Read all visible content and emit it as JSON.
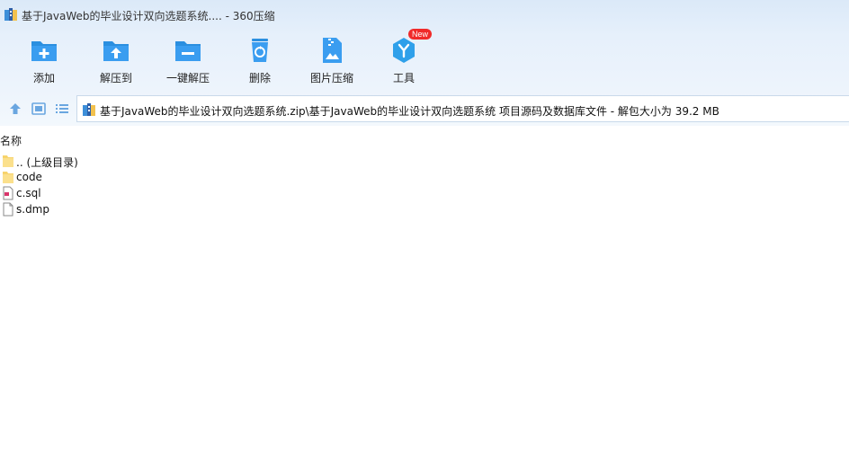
{
  "window": {
    "title": "基于JavaWeb的毕业设计双向选题系统.... - 360压缩"
  },
  "toolbar": {
    "items": [
      {
        "label": "添加",
        "icon": "add-folder-icon"
      },
      {
        "label": "解压到",
        "icon": "extract-to-icon"
      },
      {
        "label": "一键解压",
        "icon": "one-click-extract-icon"
      },
      {
        "label": "删除",
        "icon": "recycle-bin-icon"
      },
      {
        "label": "图片压缩",
        "icon": "image-compress-icon"
      },
      {
        "label": "工具",
        "icon": "tools-icon",
        "badge": "New"
      }
    ]
  },
  "navbar": {
    "path": "基于JavaWeb的毕业设计双向选题系统.zip\\基于JavaWeb的毕业设计双向选题系统 项目源码及数据库文件 - 解包大小为 39.2 MB"
  },
  "filelist": {
    "column_name": "名称",
    "rows": [
      {
        "name": ".. (上级目录)",
        "type": "parent-folder"
      },
      {
        "name": "code",
        "type": "folder"
      },
      {
        "name": "c.sql",
        "type": "sql-file"
      },
      {
        "name": "s.dmp",
        "type": "file"
      }
    ]
  },
  "colors": {
    "accent": "#2b8fe0",
    "folder": "#f7d36b",
    "badge": "#f02a2a"
  }
}
